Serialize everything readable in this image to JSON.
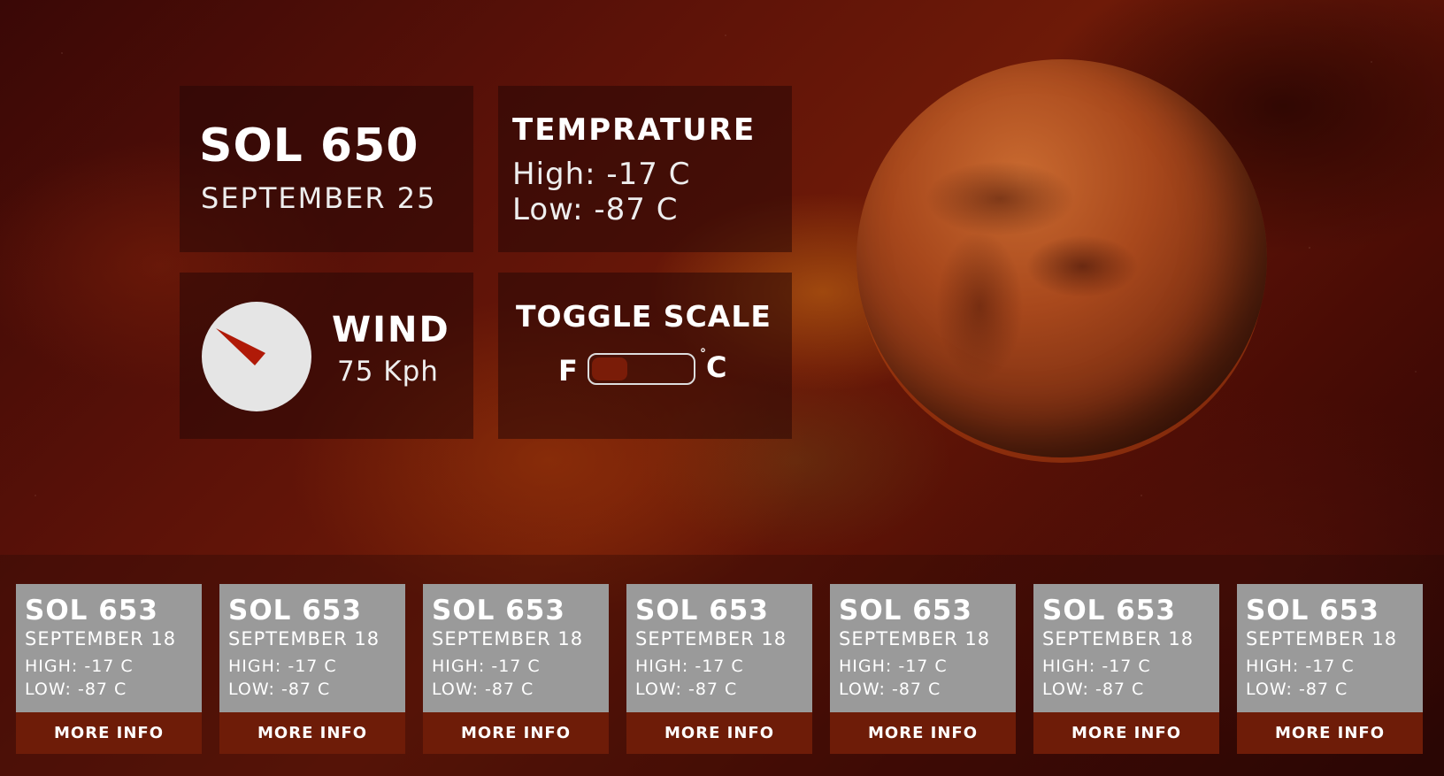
{
  "current": {
    "sol": "SOL 650",
    "date": "SEPTEMBER 25"
  },
  "temperature": {
    "title": "TEMPRATURE",
    "high": "High: -17 C",
    "low": "Low: -87 C"
  },
  "wind": {
    "title": "WIND",
    "speed": "75 Kph",
    "icon": "compass-icon"
  },
  "toggle": {
    "title": "TOGGLE SCALE",
    "left_label": "F",
    "right_label": "C",
    "degree_symbol": "°",
    "selected": "F"
  },
  "planet": {
    "icon": "mars-planet-image"
  },
  "forecast": [
    {
      "sol": "SOL 653",
      "date": "SEPTEMBER 18",
      "high": "HIGH: -17  C",
      "low": "LOW: -87  C",
      "button": "MORE INFO"
    },
    {
      "sol": "SOL 653",
      "date": "SEPTEMBER 18",
      "high": "HIGH: -17  C",
      "low": "LOW: -87  C",
      "button": "MORE INFO"
    },
    {
      "sol": "SOL 653",
      "date": "SEPTEMBER 18",
      "high": "HIGH: -17  C",
      "low": "LOW: -87  C",
      "button": "MORE INFO"
    },
    {
      "sol": "SOL 653",
      "date": "SEPTEMBER 18",
      "high": "HIGH: -17  C",
      "low": "LOW: -87  C",
      "button": "MORE INFO"
    },
    {
      "sol": "SOL 653",
      "date": "SEPTEMBER 18",
      "high": "HIGH: -17  C",
      "low": "LOW: -87  C",
      "button": "MORE INFO"
    },
    {
      "sol": "SOL 653",
      "date": "SEPTEMBER 18",
      "high": "HIGH: -17  C",
      "low": "LOW: -87  C",
      "button": "MORE INFO"
    },
    {
      "sol": "SOL 653",
      "date": "SEPTEMBER 18",
      "high": "HIGH: -17  C",
      "low": "LOW: -87  C",
      "button": "MORE INFO"
    }
  ],
  "colors": {
    "accent": "#6e1c08",
    "card_bg": "#9a9a9a",
    "compass_needle": "#b01a08"
  }
}
